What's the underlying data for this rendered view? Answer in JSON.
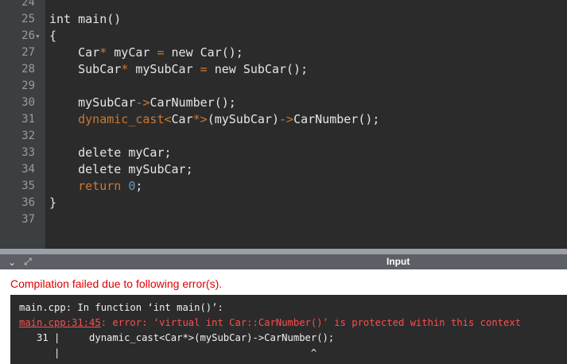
{
  "editor": {
    "lines": [
      {
        "num": "24",
        "fold": "",
        "segments": []
      },
      {
        "num": "25",
        "fold": "",
        "segments": [
          {
            "t": "int main()",
            "c": "kw"
          }
        ]
      },
      {
        "num": "26",
        "fold": "▾",
        "segments": [
          {
            "t": "{",
            "c": "kw"
          }
        ]
      },
      {
        "num": "27",
        "fold": "",
        "segments": [
          {
            "t": "    Car",
            "c": "kw"
          },
          {
            "t": "*",
            "c": "op"
          },
          {
            "t": " myCar ",
            "c": "kw"
          },
          {
            "t": "=",
            "c": "op"
          },
          {
            "t": " new Car();",
            "c": "kw"
          }
        ]
      },
      {
        "num": "28",
        "fold": "",
        "segments": [
          {
            "t": "    SubCar",
            "c": "kw"
          },
          {
            "t": "*",
            "c": "op"
          },
          {
            "t": " mySubCar ",
            "c": "kw"
          },
          {
            "t": "=",
            "c": "op"
          },
          {
            "t": " new SubCar();",
            "c": "kw"
          }
        ]
      },
      {
        "num": "29",
        "fold": "",
        "segments": []
      },
      {
        "num": "30",
        "fold": "",
        "segments": [
          {
            "t": "    mySubCar",
            "c": "kw"
          },
          {
            "t": "->",
            "c": "op"
          },
          {
            "t": "CarNumber();",
            "c": "kw"
          }
        ]
      },
      {
        "num": "31",
        "fold": "",
        "segments": [
          {
            "t": "    dynamic_cast<",
            "c": "cast"
          },
          {
            "t": "Car",
            "c": "kw"
          },
          {
            "t": "*>",
            "c": "op"
          },
          {
            "t": "(mySubCar)",
            "c": "kw"
          },
          {
            "t": "->",
            "c": "op"
          },
          {
            "t": "CarNumber();",
            "c": "kw"
          }
        ]
      },
      {
        "num": "32",
        "fold": "",
        "segments": []
      },
      {
        "num": "33",
        "fold": "",
        "segments": [
          {
            "t": "    delete myCar;",
            "c": "kw"
          }
        ]
      },
      {
        "num": "34",
        "fold": "",
        "segments": [
          {
            "t": "    delete mySubCar;",
            "c": "kw"
          }
        ]
      },
      {
        "num": "35",
        "fold": "",
        "segments": [
          {
            "t": "    return ",
            "c": "ret"
          },
          {
            "t": "0",
            "c": "num"
          },
          {
            "t": ";",
            "c": "kw"
          }
        ]
      },
      {
        "num": "36",
        "fold": "",
        "segments": [
          {
            "t": "}",
            "c": "kw"
          }
        ]
      },
      {
        "num": "37",
        "fold": "",
        "segments": []
      }
    ]
  },
  "panel": {
    "collapse_glyph": "⌄",
    "expand_glyph": "⤢",
    "input_tab_label": "Input"
  },
  "output": {
    "error_title": "Compilation failed due to following error(s).",
    "console": {
      "line1": "main.cpp: In function ‘int main()’:",
      "line2_loc": "main.cpp:31:45",
      "line2_msg": ": error: ‘virtual int Car::CarNumber()’ is protected within this context",
      "line3": "   31 |     dynamic_cast<Car*>(mySubCar)->CarNumber();",
      "line4": "      |                                           ^"
    }
  },
  "colors": {
    "editor_bg": "#2b2b2b",
    "gutter_bg": "#3c3f41",
    "operator": "#cc7832",
    "number": "#6897bb",
    "error_red": "#e00000"
  }
}
